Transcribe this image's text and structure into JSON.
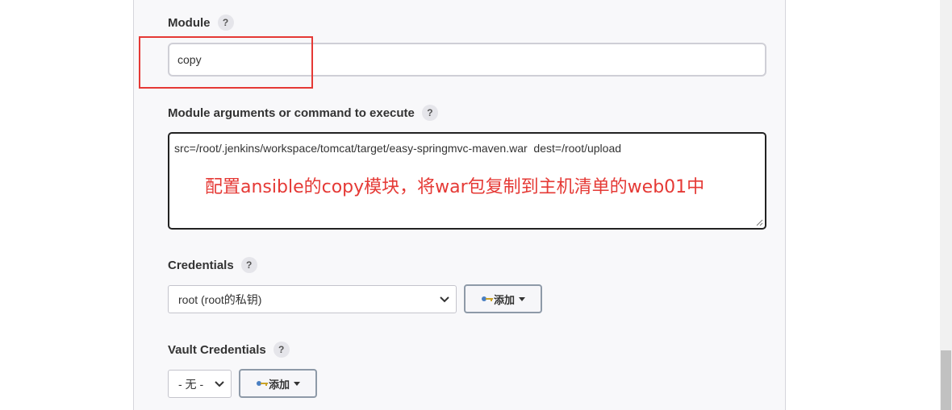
{
  "module": {
    "label": "Module",
    "help": "?",
    "value": "copy"
  },
  "args": {
    "label": "Module arguments or command to execute",
    "help": "?",
    "value": "src=/root/.jenkins/workspace/tomcat/target/easy-springmvc-maven.war  dest=/root/upload"
  },
  "annotation": "配置ansible的copy模块，将war包复制到主机清单的web01中",
  "credentials": {
    "label": "Credentials",
    "help": "?",
    "selected": "root (root的私钥)",
    "add_label": "添加"
  },
  "vault": {
    "label": "Vault Credentials",
    "help": "?",
    "selected": "- 无 -",
    "add_label": "添加"
  },
  "colors": {
    "annotation": "#e53935",
    "highlight": "#e53935"
  },
  "icons": [
    "help-icon",
    "key-icon",
    "chevron-down-icon",
    "caret-down-icon",
    "resize-handle-icon"
  ]
}
